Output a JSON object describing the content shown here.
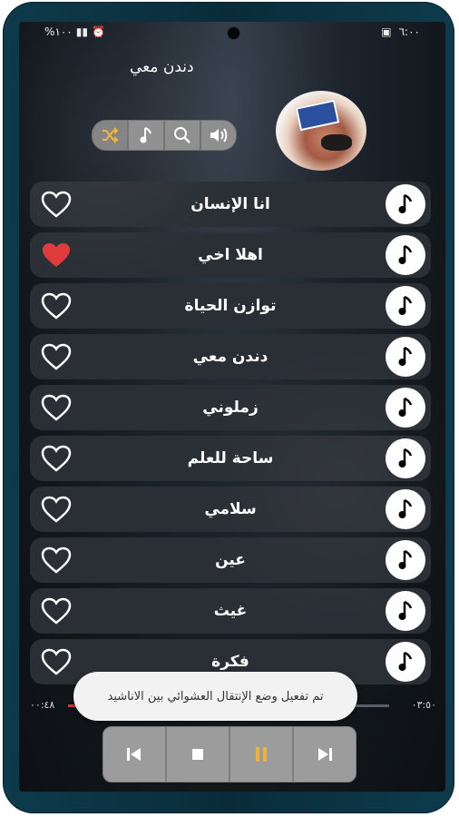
{
  "status": {
    "time": "٦:٠٠",
    "battery": "%١٠٠"
  },
  "app": {
    "title": "دندن معي"
  },
  "toolbar": {
    "icons": [
      "shuffle-icon",
      "music-note-icon",
      "search-icon",
      "volume-icon"
    ]
  },
  "songs": [
    {
      "title": "انا الإنسان",
      "favorite": false
    },
    {
      "title": "اهلا اخي",
      "favorite": true
    },
    {
      "title": "توازن الحياة",
      "favorite": false
    },
    {
      "title": "دندن معي",
      "favorite": false
    },
    {
      "title": "زملوني",
      "favorite": false
    },
    {
      "title": "ساحة للعلم",
      "favorite": false
    },
    {
      "title": "سلامي",
      "favorite": false
    },
    {
      "title": "عين",
      "favorite": false
    },
    {
      "title": "غيث",
      "favorite": false
    },
    {
      "title": "فكرة",
      "favorite": false
    }
  ],
  "player": {
    "elapsed": "٠٠:٤٨",
    "duration": "٠٣:٥٠",
    "progress": 0.21
  },
  "toast": {
    "message": "تم تفعيل وضع الإنتقال العشوائي بين الاناشيد"
  },
  "colors": {
    "accent": "#f2b134",
    "favorite": "#e03a3a",
    "row_bg": "#2a2e35"
  }
}
